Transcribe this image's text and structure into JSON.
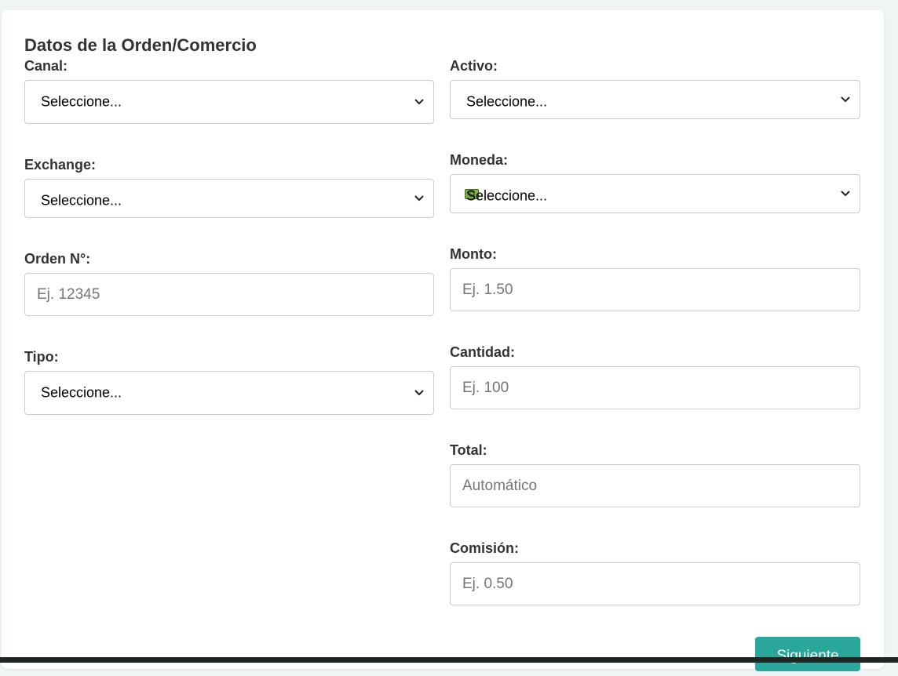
{
  "form": {
    "title": "Datos de la Orden/Comercio",
    "left": [
      {
        "label": "Canal:",
        "type": "select",
        "value": "Seleccione..."
      },
      {
        "label": "Exchange:",
        "type": "select",
        "value": "Seleccione..."
      },
      {
        "label": "Orden N°:",
        "type": "input",
        "placeholder": "Ej. 12345"
      },
      {
        "label": "Tipo:",
        "type": "select",
        "value": "Seleccione..."
      }
    ],
    "right": [
      {
        "label": "Activo:",
        "type": "select",
        "value": "Seleccione..."
      },
      {
        "label": "Moneda:",
        "type": "select",
        "value": "Seleccione...",
        "icon": "money-icon"
      },
      {
        "label": "Monto:",
        "type": "input",
        "placeholder": "Ej. 1.50"
      },
      {
        "label": "Cantidad:",
        "type": "input",
        "placeholder": "Ej. 100"
      },
      {
        "label": "Total:",
        "type": "input",
        "placeholder": "Automático"
      },
      {
        "label": "Comisión:",
        "type": "input",
        "placeholder": "Ej. 0.50"
      }
    ],
    "next_label": "Siguiente"
  },
  "colors": {
    "accent": "#2aa69a",
    "background": "#eef5f2",
    "card": "#ffffff",
    "border": "#cccccc"
  }
}
